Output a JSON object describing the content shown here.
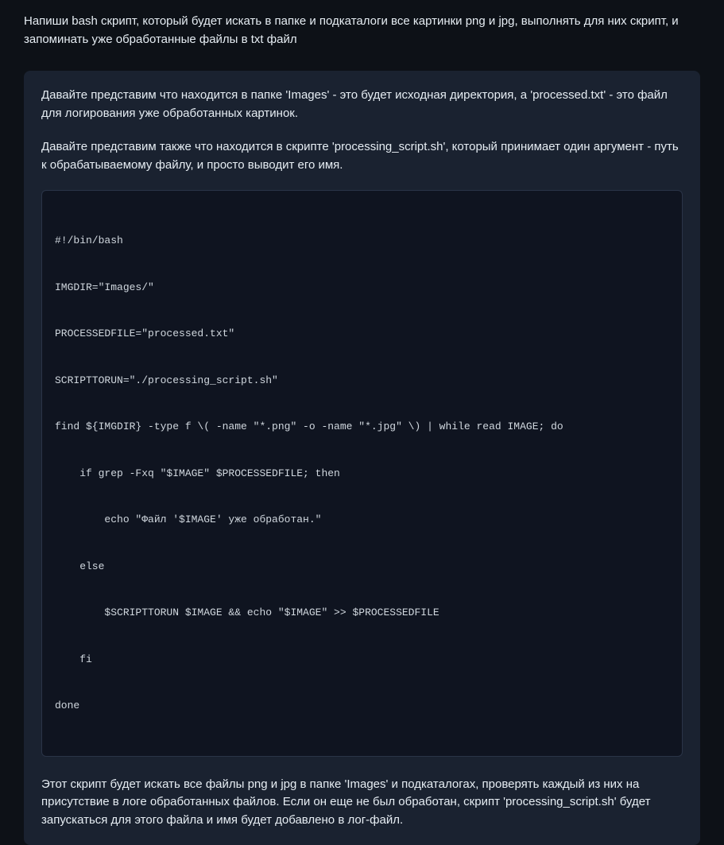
{
  "user_prompt": "Напиши bash скрипт, который будет искать в папке и подкаталоги все картинки png и jpg, выполнять для них скрипт, и запоминать уже обработанные файлы в txt файл",
  "response": {
    "intro_paragraph_1": "Давайте представим что находится в папке 'Images' - это будет исходная директория, а 'processed.txt' - это файл для логирования уже обработанных картинок.",
    "intro_paragraph_2": "Давайте представим также что находится в скрипте 'processing_script.sh', который принимает один аргумент - путь к обрабатываемому файлу, и просто выводит его имя.",
    "code_lines": [
      "#!/bin/bash",
      "IMGDIR=\"Images/\"",
      "PROCESSEDFILE=\"processed.txt\"",
      "SCRIPTTORUN=\"./processing_script.sh\"",
      "find ${IMGDIR} -type f \\( -name \"*.png\" -o -name \"*.jpg\" \\) | while read IMAGE; do",
      "    if grep -Fxq \"$IMAGE\" $PROCESSEDFILE; then",
      "        echo \"Файл '$IMAGE' уже обработан.\"",
      "    else",
      "        $SCRIPTTORUN $IMAGE && echo \"$IMAGE\" >> $PROCESSEDFILE",
      "    fi",
      "done"
    ],
    "outro_paragraph": "Этот скрипт будет искать все файлы png и jpg в папке 'Images' и подкаталогах, проверять каждый из них на присутствие в логе обработанных файлов. Если он еще не был обработан, скрипт 'processing_script.sh' будет запускаться для этого файла и имя будет добавлено в лог-файл."
  }
}
